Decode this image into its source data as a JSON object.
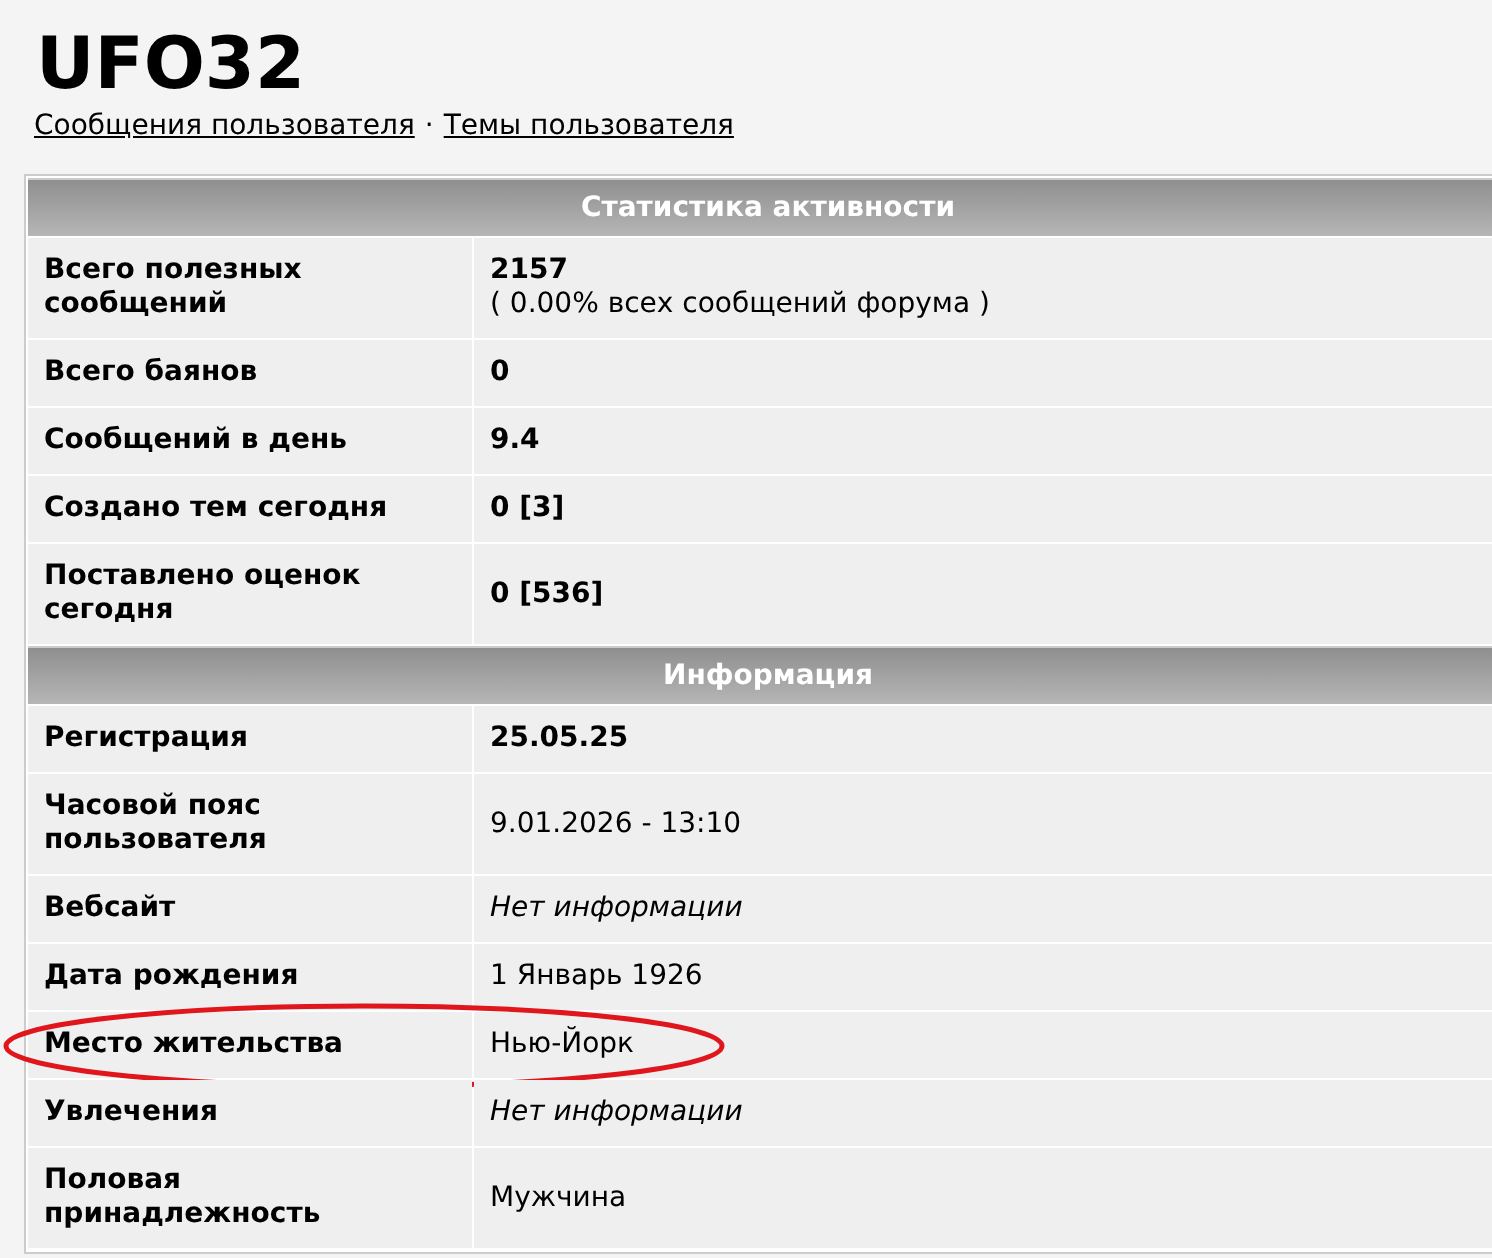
{
  "title": "UFO32",
  "links": [
    {
      "label": "Сообщения пользователя"
    },
    {
      "label": "Темы пользователя"
    }
  ],
  "link_separator": "·",
  "sections": [
    {
      "heading": "Статистика активности",
      "rows": [
        {
          "label": "Всего полезных сообщений",
          "value": "2157",
          "kind": "bold",
          "note": "( 0.00% всех сообщений форума )",
          "highlighted": false
        },
        {
          "label": "Всего баянов",
          "value": "0",
          "kind": "bold",
          "highlighted": false
        },
        {
          "label": "Сообщений в день",
          "value": "9.4",
          "kind": "bold",
          "highlighted": false
        },
        {
          "label": "Создано тем сегодня",
          "value": "0 [3]",
          "kind": "bold",
          "highlighted": false
        },
        {
          "label": "Поставлено оценок сегодня",
          "value": "0 [536]",
          "kind": "bold",
          "highlighted": false
        }
      ]
    },
    {
      "heading": "Информация",
      "rows": [
        {
          "label": "Регистрация",
          "value": "25.05.25",
          "kind": "bold",
          "highlighted": false
        },
        {
          "label": "Часовой пояс пользователя",
          "value": "9.01.2026 - 13:10",
          "kind": "plain",
          "highlighted": false
        },
        {
          "label": "Вебсайт",
          "value": "Нет информации",
          "kind": "italic",
          "highlighted": false
        },
        {
          "label": "Дата рождения",
          "value": "1 Январь 1926",
          "kind": "plain",
          "highlighted": false
        },
        {
          "label": "Место жительства",
          "value": "Нью-Йорк",
          "kind": "plain",
          "highlighted": true
        },
        {
          "label": "Увлечения",
          "value": "Нет информации",
          "kind": "italic",
          "highlighted": false
        },
        {
          "label": "Половая принадлежность",
          "value": "Мужчина",
          "kind": "plain",
          "highlighted": false
        }
      ]
    }
  ]
}
